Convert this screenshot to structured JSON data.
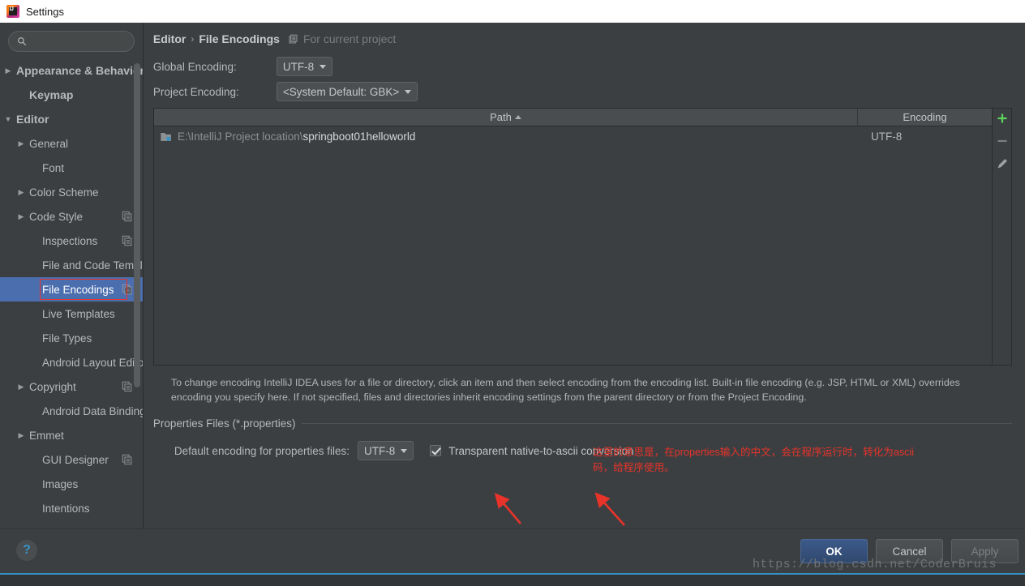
{
  "window": {
    "title": "Settings",
    "app_icon": "intellij-idea-logo"
  },
  "sidebar": {
    "search": {
      "value": "",
      "placeholder": "",
      "icon": "search-icon"
    },
    "items": [
      {
        "label": "Appearance & Behavior",
        "twisty": "collapsed",
        "bold": true,
        "indent": 0,
        "copy_icon": false,
        "selected": false
      },
      {
        "label": "Keymap",
        "twisty": "none",
        "bold": true,
        "indent": 1,
        "copy_icon": false,
        "selected": false
      },
      {
        "label": "Editor",
        "twisty": "expanded",
        "bold": true,
        "indent": 0,
        "copy_icon": false,
        "selected": false
      },
      {
        "label": "General",
        "twisty": "collapsed",
        "bold": false,
        "indent": 1,
        "copy_icon": false,
        "selected": false
      },
      {
        "label": "Font",
        "twisty": "none",
        "bold": false,
        "indent": 2,
        "copy_icon": false,
        "selected": false
      },
      {
        "label": "Color Scheme",
        "twisty": "collapsed",
        "bold": false,
        "indent": 1,
        "copy_icon": false,
        "selected": false
      },
      {
        "label": "Code Style",
        "twisty": "collapsed",
        "bold": false,
        "indent": 1,
        "copy_icon": true,
        "selected": false
      },
      {
        "label": "Inspections",
        "twisty": "none",
        "bold": false,
        "indent": 2,
        "copy_icon": true,
        "selected": false
      },
      {
        "label": "File and Code Templates",
        "twisty": "none",
        "bold": false,
        "indent": 2,
        "copy_icon": true,
        "selected": false
      },
      {
        "label": "File Encodings",
        "twisty": "none",
        "bold": false,
        "indent": 2,
        "copy_icon": true,
        "selected": true
      },
      {
        "label": "Live Templates",
        "twisty": "none",
        "bold": false,
        "indent": 2,
        "copy_icon": false,
        "selected": false
      },
      {
        "label": "File Types",
        "twisty": "none",
        "bold": false,
        "indent": 2,
        "copy_icon": false,
        "selected": false
      },
      {
        "label": "Android Layout Editor",
        "twisty": "none",
        "bold": false,
        "indent": 2,
        "copy_icon": false,
        "selected": false
      },
      {
        "label": "Copyright",
        "twisty": "collapsed",
        "bold": false,
        "indent": 1,
        "copy_icon": true,
        "selected": false
      },
      {
        "label": "Android Data Binding",
        "twisty": "none",
        "bold": false,
        "indent": 2,
        "copy_icon": false,
        "selected": false
      },
      {
        "label": "Emmet",
        "twisty": "collapsed",
        "bold": false,
        "indent": 1,
        "copy_icon": false,
        "selected": false
      },
      {
        "label": "GUI Designer",
        "twisty": "none",
        "bold": false,
        "indent": 2,
        "copy_icon": true,
        "selected": false
      },
      {
        "label": "Images",
        "twisty": "none",
        "bold": false,
        "indent": 2,
        "copy_icon": false,
        "selected": false
      },
      {
        "label": "Intentions",
        "twisty": "none",
        "bold": false,
        "indent": 2,
        "copy_icon": false,
        "selected": false
      }
    ]
  },
  "content": {
    "breadcrumb": {
      "parent": "Editor",
      "separator": "›",
      "current": "File Encodings",
      "scope_icon": "project-scope-icon",
      "scope_note": "For current project"
    },
    "global_encoding": {
      "label": "Global Encoding:",
      "value": "UTF-8"
    },
    "project_encoding": {
      "label": "Project Encoding:",
      "value": "<System Default: GBK>"
    },
    "table": {
      "columns": [
        "Path",
        "Encoding"
      ],
      "sort_column": "Path",
      "sort_direction": "asc",
      "rows": [
        {
          "icon": "folder-icon",
          "path_prefix": "E:\\IntelliJ Project location\\",
          "path_name": "springboot01helloworld",
          "encoding": "UTF-8"
        }
      ],
      "tools": [
        "add-icon",
        "remove-icon",
        "edit-icon"
      ]
    },
    "description": "To change encoding IntelliJ IDEA uses for a file or directory, click an item and then select encoding from the encoding list. Built-in file encoding (e.g. JSP, HTML or XML) overrides encoding you specify here. If not specified, files and directories inherit encoding settings from the parent directory or from the Project Encoding.",
    "properties_group": {
      "title": "Properties Files (*.properties)",
      "default_encoding_label": "Default encoding for properties files:",
      "default_encoding_value": "UTF-8",
      "checkbox_label": "Transparent native-to-ascii conversion",
      "checkbox_checked": true
    }
  },
  "annotations": {
    "note_text": "这里的意思是，在properties输入的中文，会在程序运行时，转化为ascii\n码，给程序使用。",
    "color": "#e8332a",
    "arrows": 2,
    "highlight_target": "File Encodings"
  },
  "footer": {
    "help_glyph": "?",
    "buttons": [
      {
        "label": "OK",
        "primary": true,
        "disabled": false
      },
      {
        "label": "Cancel",
        "primary": false,
        "disabled": false
      },
      {
        "label": "Apply",
        "primary": false,
        "disabled": true
      }
    ]
  },
  "watermark": {
    "text": "https://blog.csdn.net/CoderBruis"
  }
}
